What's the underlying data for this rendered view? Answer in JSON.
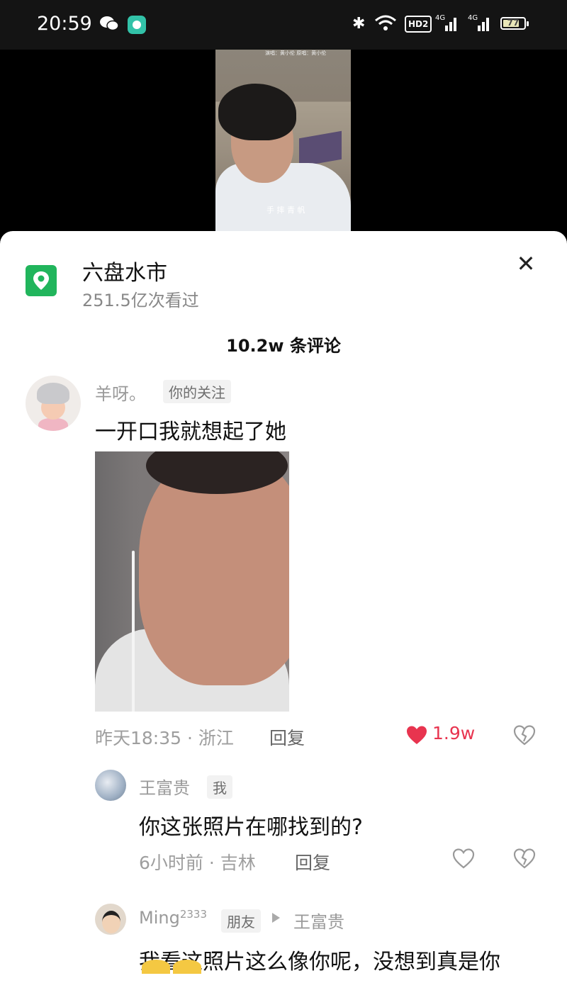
{
  "status_bar": {
    "time": "20:59",
    "hd_label": "HD2",
    "net1": "4G",
    "net2": "4G",
    "battery": "77"
  },
  "video": {
    "caption": "手 摔 青 帆",
    "top_text": "演唱：黄小伦  原唱：黄小伦"
  },
  "location": {
    "title": "六盘水市",
    "views": "251.5亿次看过"
  },
  "comment_count": "10.2w 条评论",
  "comments": [
    {
      "user": "羊呀。",
      "tag": "你的关注",
      "text": "一开口我就想起了她",
      "meta": "昨天18:35 · 浙江",
      "reply": "回复",
      "likes": "1.9w"
    },
    {
      "user": "王富贵",
      "tag": "我",
      "text": "你这张照片在哪找到的?",
      "meta": "6小时前 · 吉林",
      "reply": "回复"
    },
    {
      "user": "Ming",
      "user_sup": "2333",
      "tag": "朋友",
      "reply_to": "王富贵",
      "text": "我看这照片这么像你呢，没想到真是你"
    }
  ],
  "icons": {
    "location": "map-pin-icon",
    "close": "close-icon",
    "like": "heart-icon",
    "dislike": "broken-heart-icon"
  },
  "colors": {
    "accent_red": "#e8344f",
    "location_green": "#21b55c"
  }
}
